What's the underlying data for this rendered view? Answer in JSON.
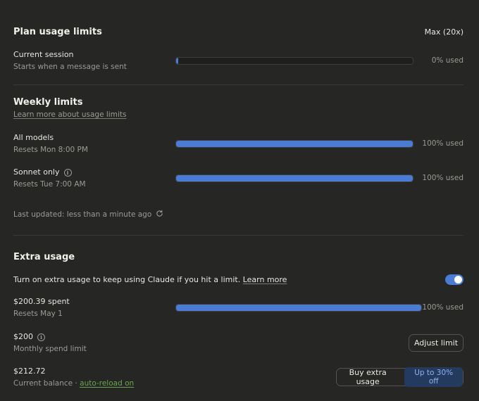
{
  "plan": {
    "title": "Plan usage limits",
    "tier": "Max (20x)",
    "session": {
      "label": "Current session",
      "sub": "Starts when a message is sent",
      "used_text": "0% used",
      "progress": 0.01
    }
  },
  "weekly": {
    "title": "Weekly limits",
    "learn_more": "Learn more about usage limits",
    "all_models": {
      "label": "All models",
      "sub": "Resets Mon 8:00 PM",
      "used_text": "100% used",
      "progress": 1.0
    },
    "sonnet": {
      "label": "Sonnet only",
      "sub": "Resets Tue 7:00 AM",
      "used_text": "100% used",
      "progress": 1.0
    },
    "last_updated": "Last updated: less than a minute ago"
  },
  "extra": {
    "title": "Extra usage",
    "description": "Turn on extra usage to keep using Claude if you hit a limit.",
    "learn_more": "Learn more",
    "toggle_on": true,
    "spent": {
      "label": "$200.39 spent",
      "sub": "Resets May 1",
      "used_text": "100% used",
      "progress": 1.0
    },
    "limit": {
      "label": "$200",
      "sub": "Monthly spend limit",
      "button": "Adjust limit"
    },
    "balance": {
      "label": "$212.72",
      "sub_prefix": "Current balance ·",
      "auto_reload": "auto-reload on",
      "button": "Buy extra usage",
      "badge": "Up to 30% off"
    }
  },
  "colors": {
    "accent": "#4a7bd5",
    "background": "#262624",
    "link_green": "#6aa84f"
  }
}
